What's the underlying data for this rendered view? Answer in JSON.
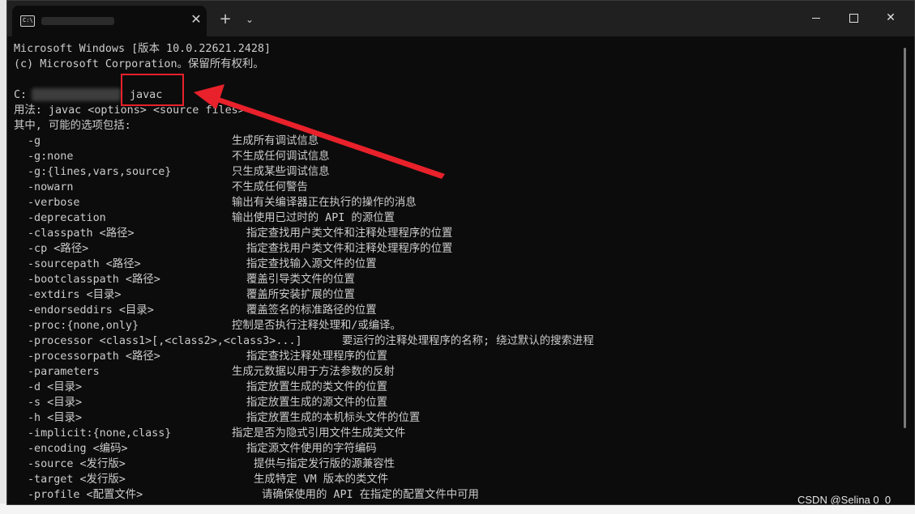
{
  "window": {
    "tab_icon_text": "C:\\",
    "tab_close": "✕",
    "new_tab": "+",
    "dropdown": "⌄",
    "close": "✕"
  },
  "header_lines": [
    "Microsoft Windows [版本 10.0.22621.2428]",
    "(c) Microsoft Corporation。保留所有权利。"
  ],
  "prompt": {
    "prefix": "C:",
    "command": "javac"
  },
  "usage_lines": [
    "用法: javac <options> <source files>",
    "其中, 可能的选项包括:"
  ],
  "options": [
    {
      "opt": "-g",
      "desc": "生成所有调试信息"
    },
    {
      "opt": "-g:none",
      "desc": "不生成任何调试信息"
    },
    {
      "opt": "-g:{lines,vars,source}",
      "desc": "只生成某些调试信息"
    },
    {
      "opt": "-nowarn",
      "desc": "不生成任何警告"
    },
    {
      "opt": "-verbose",
      "desc": "输出有关编译器正在执行的操作的消息"
    },
    {
      "opt": "-deprecation",
      "desc": "输出使用已过时的 API 的源位置"
    },
    {
      "opt": "-classpath <路径>",
      "desc": "指定查找用户类文件和注释处理程序的位置"
    },
    {
      "opt": "-cp <路径>",
      "desc": "指定查找用户类文件和注释处理程序的位置"
    },
    {
      "opt": "-sourcepath <路径>",
      "desc": "指定查找输入源文件的位置"
    },
    {
      "opt": "-bootclasspath <路径>",
      "desc": "覆盖引导类文件的位置"
    },
    {
      "opt": "-extdirs <目录>",
      "desc": "覆盖所安装扩展的位置"
    },
    {
      "opt": "-endorseddirs <目录>",
      "desc": "覆盖签名的标准路径的位置"
    },
    {
      "opt": "-proc:{none,only}",
      "desc": "控制是否执行注释处理和/或编译。"
    },
    {
      "opt": "-processor <class1>[,<class2>,<class3>...]",
      "desc": "要运行的注释处理程序的名称; 绕过默认的搜索进程"
    },
    {
      "opt": "-processorpath <路径>",
      "desc": "指定查找注释处理程序的位置"
    },
    {
      "opt": "-parameters",
      "desc": "生成元数据以用于方法参数的反射"
    },
    {
      "opt": "-d <目录>",
      "desc": "指定放置生成的类文件的位置"
    },
    {
      "opt": "-s <目录>",
      "desc": "指定放置生成的源文件的位置"
    },
    {
      "opt": "-h <目录>",
      "desc": "指定放置生成的本机标头文件的位置"
    },
    {
      "opt": "-implicit:{none,class}",
      "desc": "指定是否为隐式引用文件生成类文件"
    },
    {
      "opt": "-encoding <编码>",
      "desc": "指定源文件使用的字符编码"
    },
    {
      "opt": "-source <发行版>",
      "desc": "提供与指定发行版的源兼容性"
    },
    {
      "opt": "-target <发行版>",
      "desc": "生成特定 VM 版本的类文件"
    },
    {
      "opt": "-profile <配置文件>",
      "desc": "请确保使用的 API 在指定的配置文件中可用"
    }
  ],
  "watermark": "CSDN @Selina 0_0",
  "colors": {
    "terminal_bg": "#0c0c0c",
    "titlebar_bg": "#202020",
    "text": "#cccccc",
    "annotation_red": "#e8212b"
  }
}
